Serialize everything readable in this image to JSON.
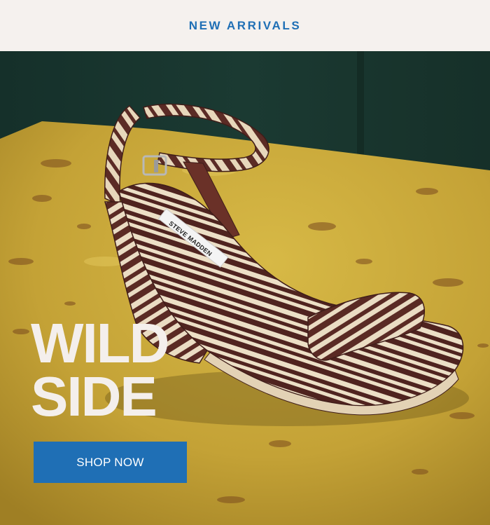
{
  "header": {
    "title": "NEW ARRIVALS"
  },
  "hero": {
    "image_alt": "Zebra print raffia wedge sandal with ankle strap on a yellow stone surface",
    "shoe_label": "STEVE MADDEN",
    "headline_line1": "WILD",
    "headline_line2": "SIDE",
    "cta_label": "SHOP NOW"
  },
  "colors": {
    "accent": "#1f6fb5",
    "background": "#f5f1ee",
    "headline": "#f4efec",
    "backdrop": "#17332c",
    "surface": "#c8a738"
  }
}
